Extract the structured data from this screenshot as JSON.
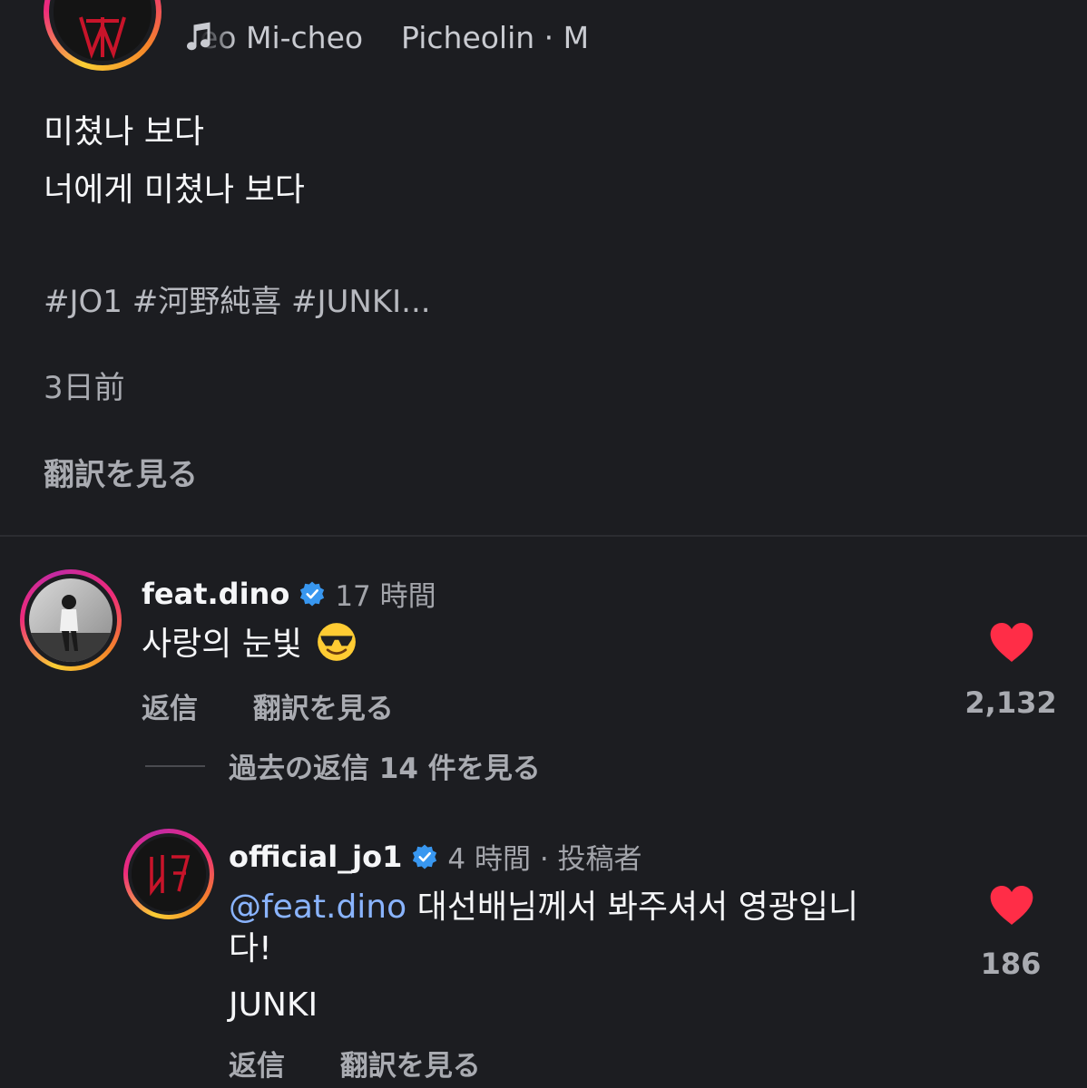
{
  "post": {
    "music": {
      "icon": "music-note-icon",
      "track_text": "eo Mi-cheo    Picheolin · M"
    },
    "caption": [
      "미쳤나 보다",
      "너에게 미쳤나 보다"
    ],
    "hashtags": "#JO1 #河野純喜 #JUNKI...",
    "time_ago": "3日前",
    "see_translation": "翻訳を見る"
  },
  "comments": [
    {
      "username": "feat.dino",
      "verified": true,
      "time": "17 時間",
      "text": "사랑의 눈빛",
      "emoji": "smiling-face-with-sunglasses",
      "reply_label": "返信",
      "translate_label": "翻訳を見る",
      "like_count": "2,132",
      "liked": true
    }
  ],
  "view_replies_label": "過去の返信 14 件を見る",
  "replies": [
    {
      "username": "official_jo1",
      "verified": true,
      "time": "4 時間 · 投稿者",
      "mention": "@feat.dino",
      "text_line1": " 대선배님께서 봐주셔서 영광입니",
      "text_line2": "다!",
      "text_line3": "JUNKI",
      "reply_label": "返信",
      "translate_label": "翻訳を見る",
      "like_count": "186",
      "liked": true
    }
  ],
  "colors": {
    "background": "#1c1d21",
    "like_red": "#ff2d47",
    "mention_blue": "#8ab4ff",
    "verified_blue": "#3897f0"
  }
}
